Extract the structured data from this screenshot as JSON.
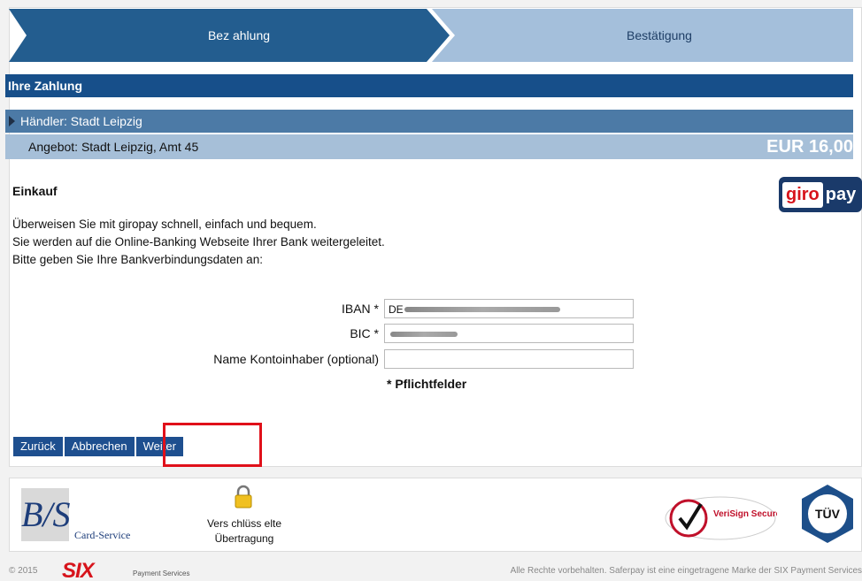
{
  "steps": {
    "step1": "Bez ahlung",
    "step2": "Bestätigung"
  },
  "payment": {
    "header": "Ihre Zahlung",
    "merchant": "Händler: Stadt Leipzig",
    "offer": "Angebot: Stadt Leipzig, Amt 45",
    "amount": "EUR 16,00"
  },
  "purchase": {
    "title": "Einkauf",
    "logo_part1": "giro",
    "logo_part2": "pay",
    "line1": "Überweisen Sie mit giropay schnell, einfach und bequem.",
    "line2": "Sie werden auf die Online-Banking Webseite Ihrer Bank weitergeleitet.",
    "line3": "Bitte geben Sie Ihre Bankverbindungsdaten an:"
  },
  "form": {
    "iban_label": "IBAN *",
    "iban_value": "DE",
    "bic_label": "BIC *",
    "name_label": "Name Kontoinhaber (optional)",
    "required_note": "* Pflichtfelder"
  },
  "buttons": {
    "back": "Zurück",
    "cancel": "Abbrechen",
    "next": "Weiter"
  },
  "footer": {
    "bs_logo": "B/S",
    "card_service": "Card-Service",
    "encrypted_line1": "Vers chlüss elte",
    "encrypted_line2": "Übertragung",
    "verisign": "VeriSign Secured",
    "tuv": "TÜV",
    "copyright": "© 2015",
    "six": "SIX",
    "six_sub": "Payment Services",
    "rights": "Alle Rechte vorbehalten. Saferpay ist eine eingetragene Marke der SIX Payment Services"
  },
  "colors": {
    "accent": "#174f8a",
    "highlight": "#e0101a"
  }
}
